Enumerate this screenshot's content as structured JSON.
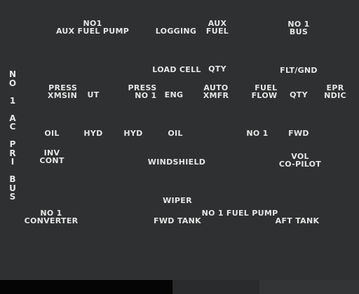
{
  "panel": {
    "bus_title": "N\nO\n \n1\n \nA\nC\n \nP\nR\nI\n \nB\nU\nS",
    "labels": {
      "no1_aux_fuel_pump": "NO1\nAUX FUEL PUMP",
      "logging": "LOGGING",
      "aux_fuel": "AUX\nFUEL",
      "no1_bus": "NO 1\nBUS",
      "load_cell": "LOAD CELL",
      "qty": "QTY",
      "flt_gnd": "FLT/GND",
      "press_xmsin": "PRESS\nXMSIN",
      "ut": "UT",
      "press_no1": "PRESS\nNO 1",
      "eng": "ENG",
      "auto_xmfr": "AUTO\nXMFR",
      "fuel_flow": "FUEL\nFLOW",
      "fuel_qty": "QTY",
      "epr_ndic": "EPR\nNDIC",
      "oil_1": "OIL",
      "hyd_1": "HYD",
      "hyd_2": "HYD",
      "oil_2": "OIL",
      "no1": "NO 1",
      "fwd": "FWD",
      "inv_cont": "INV\nCONT",
      "windshield": "WINDSHIELD",
      "vol_copilot": "VOL\nCO-PILOT",
      "wiper": "WIPER",
      "no1_converter": "NO 1\nCONVERTER",
      "fwd_tank": "FWD TANK",
      "no1_fuel_pump": "NO 1 FUEL PUMP",
      "aft_tank": "AFT TANK"
    }
  },
  "colors": {
    "background": "#2f3031",
    "text": "#e6e6e6"
  }
}
